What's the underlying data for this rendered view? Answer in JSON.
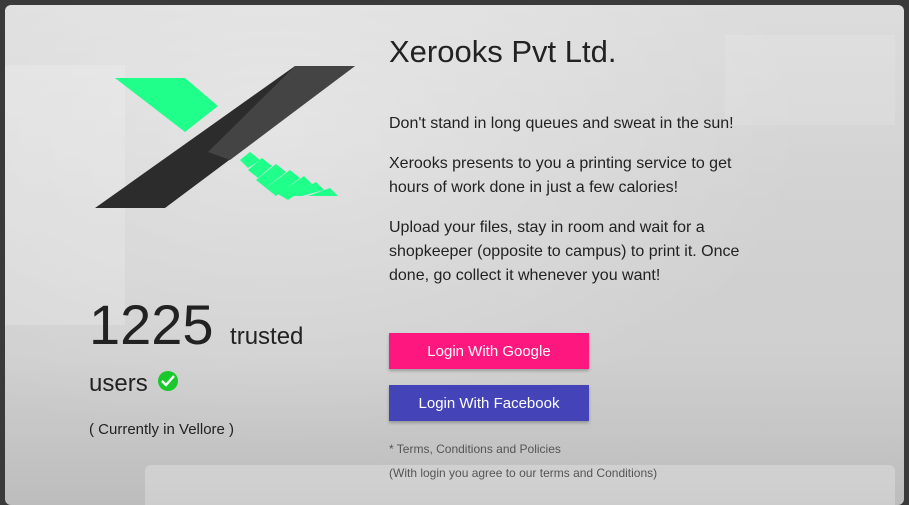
{
  "brand": {
    "logo_icon": "xerooks-x-logo",
    "company_name": "Xerooks Pvt Ltd.",
    "colors": {
      "accent_green": "#1fff8a",
      "logo_dark": "#2c2c2c"
    }
  },
  "stats": {
    "count": "1225",
    "trusted_label": "trusted",
    "users_label": "users",
    "verified_icon": "check-circle-icon",
    "location": "( Currently in Vellore )"
  },
  "intro": {
    "p1": "Don't stand in long queues and sweat in the sun!",
    "p2": "Xerooks presents to you a printing service to get hours of work done in just a few calories!",
    "p3": "Upload your files, stay in room and wait for a shopkeeper (opposite to campus) to print it. Once done, go collect it whenever you want!"
  },
  "auth": {
    "google_label": "Login With Google",
    "facebook_label": "Login With Facebook",
    "google_color": "#ff1780",
    "facebook_color": "#4444b8",
    "terms_link": "* Terms, Conditions and Policies",
    "terms_note": "(With login you agree to our terms and Conditions)"
  }
}
